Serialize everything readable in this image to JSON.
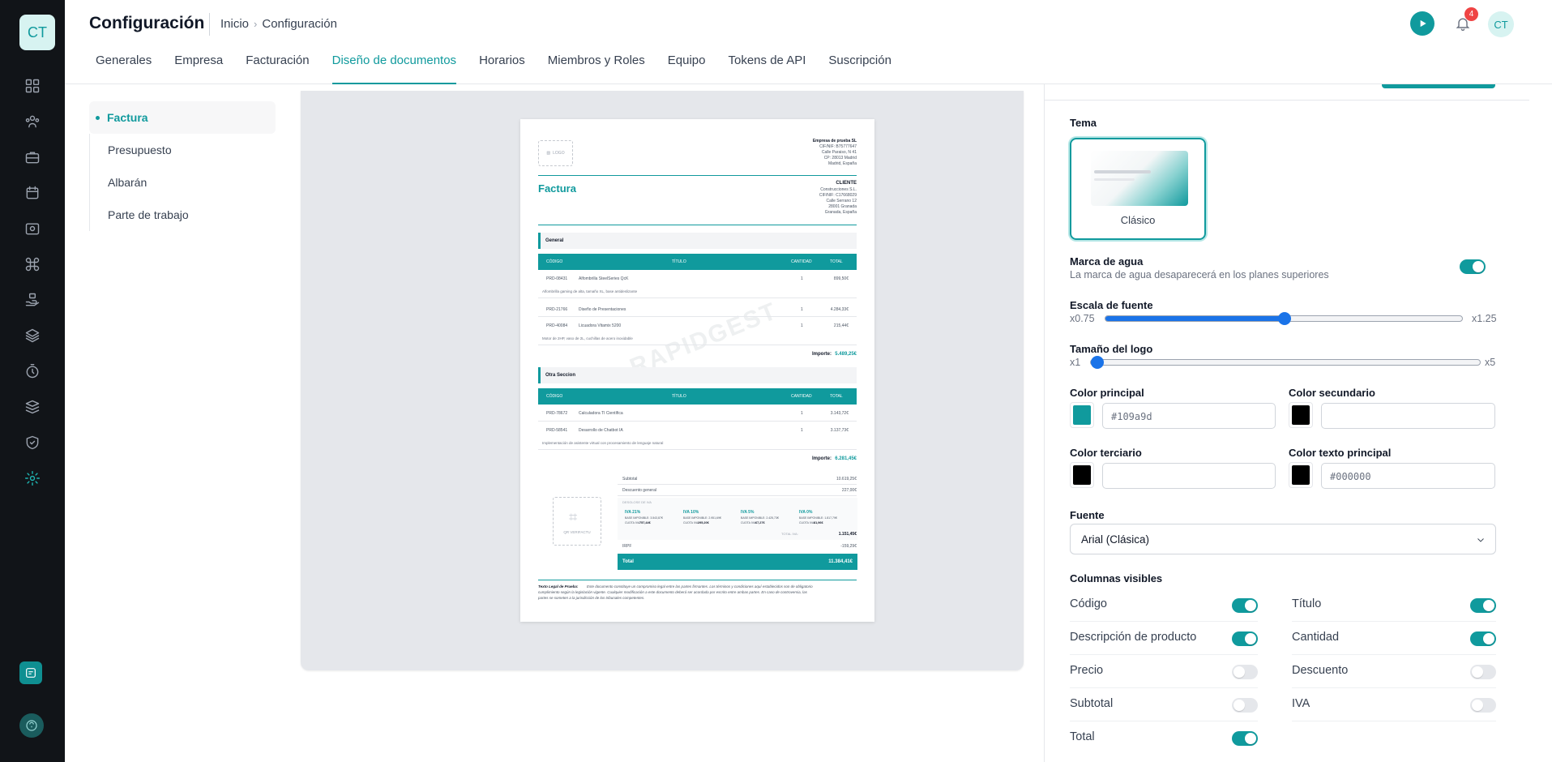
{
  "sidebar": {
    "logo_text": "CT",
    "items": [
      {
        "icon": "dashboard-grid-icon"
      },
      {
        "icon": "users-icon"
      },
      {
        "icon": "briefcase-icon"
      },
      {
        "icon": "calendar-icon"
      },
      {
        "icon": "camera-icon"
      },
      {
        "icon": "command-icon"
      },
      {
        "icon": "hand-stack-icon"
      },
      {
        "icon": "layers-icon"
      },
      {
        "icon": "timer-icon"
      },
      {
        "icon": "stack-icon"
      },
      {
        "icon": "shield-check-icon"
      },
      {
        "icon": "gear-icon",
        "active": true
      }
    ]
  },
  "header": {
    "title": "Configuración",
    "breadcrumb": [
      "Inicio",
      "Configuración"
    ],
    "notifications_count": "4",
    "avatar_initials": "CT"
  },
  "tabs": [
    "Generales",
    "Empresa",
    "Facturación",
    "Diseño de documentos",
    "Horarios",
    "Miembros y Roles",
    "Equipo",
    "Tokens de API",
    "Suscripción"
  ],
  "active_tab": "Diseño de documentos",
  "document_types": [
    "Factura",
    "Presupuesto",
    "Albarán",
    "Parte de trabajo"
  ],
  "preview": {
    "logo_placeholder": "LOGO",
    "company": [
      "Empresa de prueba SL",
      "CIF/NIF: B75777647",
      "Calle Paraiso, N 41",
      "CP: 28013 Madrid",
      "Madrid, España"
    ],
    "doc_title": "Factura",
    "client_heading": "CLIENTE",
    "client": [
      "Construcciones S.L.",
      "CIF/NIF: C17668029",
      "Calle Serrano 12",
      "28001 Granada",
      "Granada, España"
    ],
    "col_headers": [
      "CÓDIGO",
      "TÍTULO",
      "CANTIDAD",
      "TOTAL"
    ],
    "sections": [
      {
        "name": "General",
        "rows": [
          {
            "code": "PRD-08431",
            "title": "Alfombrilla SteelSeries QcK",
            "qty": "1",
            "total": "899,50€",
            "desc": "Alfombrilla gaming de alta, tamaño XL, base antideslizante"
          },
          {
            "code": "PRD-21766",
            "title": "Diseño de Presentaciones",
            "qty": "1",
            "total": "4.284,33€",
            "desc": ""
          },
          {
            "code": "PRD-40084",
            "title": "Licuadora Vitamix 5200",
            "qty": "1",
            "total": "215,44€",
            "desc": "Motor de 2HP, vaso de 2L, cuchillas de acero inoxidable"
          }
        ],
        "importe_label": "Importe:",
        "importe": "5.489,25€"
      },
      {
        "name": "Otra Seccion",
        "rows": [
          {
            "code": "PRD-78672",
            "title": "Calculadora TI Científica",
            "qty": "1",
            "total": "3.143,72€",
            "desc": ""
          },
          {
            "code": "PRD-58541",
            "title": "Desarrollo de Chatbot IA",
            "qty": "1",
            "total": "3.137,73€",
            "desc": "Implementación de asistente virtual con procesamiento de lenguaje natural"
          }
        ],
        "importe_label": "Importe:",
        "importe": "6.281,45€"
      }
    ],
    "summary": [
      {
        "label": "Subtotal",
        "value": "10.619,25€"
      },
      {
        "label": "Descuento general",
        "value": "227,00€"
      }
    ],
    "tax_heading": "DESGLOSE DE IVA",
    "taxes": [
      {
        "name": "IVA 21%",
        "base": "BASE IMPONIBLE: 3.543,87€",
        "cuota_label": "CUOTA IVA:",
        "cuota": "757,44€"
      },
      {
        "name": "IVA 10%",
        "base": "BASE IMPONIBLE: 2.951,69€",
        "cuota_label": "CUOTA IVA:",
        "cuota": "295,20€"
      },
      {
        "name": "IVA 5%",
        "base": "BASE IMPONIBLE: 2.425,73€",
        "cuota_label": "CUOTA IVA:",
        "cuota": "67,27€"
      },
      {
        "name": "IVA 0%",
        "base": "BASE IMPONIBLE: 1.817,79€",
        "cuota_label": "CUOTA IVA:",
        "cuota": "81,96€"
      }
    ],
    "total_iva_label": "TOTAL IVA:",
    "total_iva": "1.151,45€",
    "irpf_label": "IRPF",
    "irpf": "-159,29€",
    "total_label": "Total",
    "total": "11.384,41€",
    "qr_label": "QR VERIFACTU",
    "watermark": "RAPIDGEST",
    "legal_title": "Texto Legal de Prueba:",
    "legal_text": [
      "Este documento constituye un compromiso legal entre las partes firmantes. Los términos y condiciones aquí establecidos son de obligatorio",
      "cumplimiento según la legislación vigente. Cualquier modificación a este documento deberá ser acordada por escrito entre ambas partes. En caso de controversia, las",
      "partes se someten a la jurisdicción de los tribunales competentes."
    ]
  },
  "settings": {
    "theme_label": "Tema",
    "theme_name": "Clásico",
    "watermark_label": "Marca de agua",
    "watermark_sub": "La marca de agua desaparecerá en los planes superiores",
    "watermark_on": true,
    "font_scale_label": "Escala de fuente",
    "font_scale_min": "x0.75",
    "font_scale_max": "x1.25",
    "font_scale_fraction": 0.5,
    "logo_size_label": "Tamaño del logo",
    "logo_size_min": "x1",
    "logo_size_max": "x5",
    "logo_size_fraction": 0,
    "colors": [
      {
        "label": "Color principal",
        "value": "#109a9d",
        "swatch": "#109a9d"
      },
      {
        "label": "Color secundario",
        "value": "",
        "swatch": "#000000"
      },
      {
        "label": "Color terciario",
        "value": "",
        "swatch": "#000000"
      },
      {
        "label": "Color texto principal",
        "value": "#000000",
        "swatch": "#000000"
      }
    ],
    "font_label": "Fuente",
    "font_value": "Arial (Clásica)",
    "columns_label": "Columnas visibles",
    "columns": [
      {
        "name": "Código",
        "on": true
      },
      {
        "name": "Título",
        "on": true
      },
      {
        "name": "Descripción de producto",
        "on": true
      },
      {
        "name": "Cantidad",
        "on": true
      },
      {
        "name": "Precio",
        "on": false
      },
      {
        "name": "Descuento",
        "on": false
      },
      {
        "name": "Subtotal",
        "on": false
      },
      {
        "name": "IVA",
        "on": false
      },
      {
        "name": "Total",
        "on": true
      }
    ]
  },
  "colors": {
    "accent": "#109a9d",
    "sidebar_bg": "#111418",
    "badge": "#ef4444",
    "slider": "#1a73e8"
  }
}
